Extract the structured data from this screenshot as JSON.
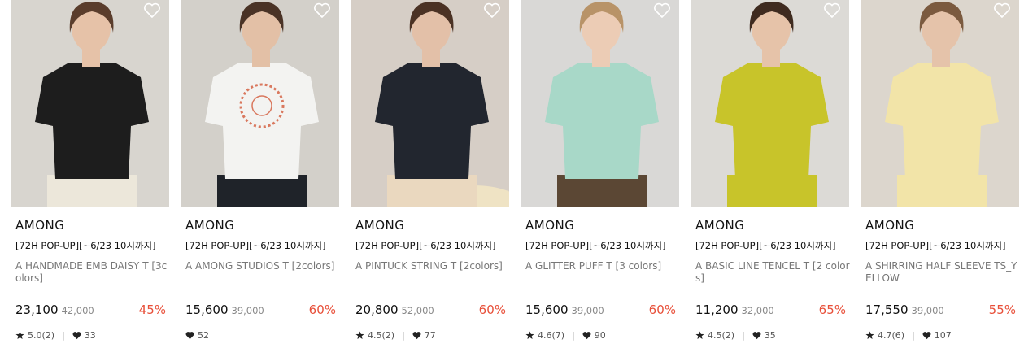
{
  "products": [
    {
      "brand": "AMONG",
      "promo": "[72H POP-UP][~6/23 10시까지]",
      "name": "A HANDMADE EMB DAISY T [3colors]",
      "price": "23,100",
      "original_price": "42,000",
      "discount": "45%",
      "rating": "5.0(2)",
      "likes": "33",
      "colors": {
        "bg": "#d8d5cf",
        "top": "#1d1d1d",
        "bottom": "#ece7da",
        "skin": "#e6c2a8",
        "hair": "#5a3d2c"
      }
    },
    {
      "brand": "AMONG",
      "promo": "[72H POP-UP][~6/23 10시까지]",
      "name": "A AMONG STUDIOS T [2colors]",
      "price": "15,600",
      "original_price": "39,000",
      "discount": "60%",
      "rating": "",
      "likes": "52",
      "colors": {
        "bg": "#d3d0ca",
        "top": "#f3f3f1",
        "bottom": "#1f2329",
        "skin": "#e3c0a6",
        "hair": "#4a3326",
        "print": "#d9785e"
      }
    },
    {
      "brand": "AMONG",
      "promo": "[72H POP-UP][~6/23 10시까지]",
      "name": "A PINTUCK STRING T [2colors]",
      "price": "20,800",
      "original_price": "52,000",
      "discount": "60%",
      "rating": "4.5(2)",
      "likes": "77",
      "colors": {
        "bg": "#d6cec6",
        "top": "#22262f",
        "bottom": "#ead8bf",
        "skin": "#e3c0a8",
        "hair": "#4b3224",
        "prop": "#efe3c4"
      }
    },
    {
      "brand": "AMONG",
      "promo": "[72H POP-UP][~6/23 10시까지]",
      "name": "A GLITTER PUFF T [3 colors]",
      "price": "15,600",
      "original_price": "39,000",
      "discount": "60%",
      "rating": "4.6(7)",
      "likes": "90",
      "colors": {
        "bg": "#d9d8d6",
        "top": "#a8d8c8",
        "bottom": "#5b4734",
        "skin": "#ecccb5",
        "hair": "#b89368"
      }
    },
    {
      "brand": "AMONG",
      "promo": "[72H POP-UP][~6/23 10시까지]",
      "name": "A BASIC LINE TENCEL T [2 colors]",
      "price": "11,200",
      "original_price": "32,000",
      "discount": "65%",
      "rating": "4.5(2)",
      "likes": "35",
      "colors": {
        "bg": "#dcdad6",
        "top": "#c8c42a",
        "bottom": "#c8c42a",
        "skin": "#e6c3a9",
        "hair": "#3f2b20"
      }
    },
    {
      "brand": "AMONG",
      "promo": "[72H POP-UP][~6/23 10시까지]",
      "name": "A SHIRRING HALF SLEEVE TS_YELLOW",
      "price": "17,550",
      "original_price": "39,000",
      "discount": "55%",
      "rating": "4.7(6)",
      "likes": "107",
      "colors": {
        "bg": "#dcd6cd",
        "top": "#f2e4a8",
        "bottom": "#f2e4a8",
        "skin": "#e5c3aa",
        "hair": "#7b5a3f"
      }
    }
  ],
  "icons": {
    "wish": "heart-outline-icon",
    "rating": "star-icon",
    "likes": "heart-filled-icon"
  }
}
